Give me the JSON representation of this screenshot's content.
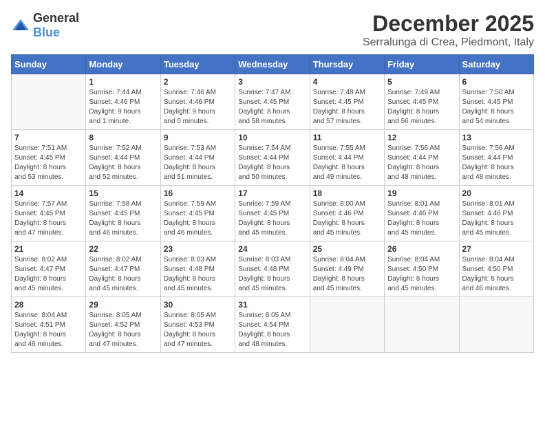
{
  "logo": {
    "general": "General",
    "blue": "Blue"
  },
  "header": {
    "month": "December 2025",
    "location": "Serralunga di Crea, Piedmont, Italy"
  },
  "weekdays": [
    "Sunday",
    "Monday",
    "Tuesday",
    "Wednesday",
    "Thursday",
    "Friday",
    "Saturday"
  ],
  "weeks": [
    [
      {
        "day": "",
        "info": ""
      },
      {
        "day": "1",
        "info": "Sunrise: 7:44 AM\nSunset: 4:46 PM\nDaylight: 9 hours\nand 1 minute."
      },
      {
        "day": "2",
        "info": "Sunrise: 7:46 AM\nSunset: 4:46 PM\nDaylight: 9 hours\nand 0 minutes."
      },
      {
        "day": "3",
        "info": "Sunrise: 7:47 AM\nSunset: 4:45 PM\nDaylight: 8 hours\nand 58 minutes."
      },
      {
        "day": "4",
        "info": "Sunrise: 7:48 AM\nSunset: 4:45 PM\nDaylight: 8 hours\nand 57 minutes."
      },
      {
        "day": "5",
        "info": "Sunrise: 7:49 AM\nSunset: 4:45 PM\nDaylight: 8 hours\nand 56 minutes."
      },
      {
        "day": "6",
        "info": "Sunrise: 7:50 AM\nSunset: 4:45 PM\nDaylight: 8 hours\nand 54 minutes."
      }
    ],
    [
      {
        "day": "7",
        "info": "Sunrise: 7:51 AM\nSunset: 4:45 PM\nDaylight: 8 hours\nand 53 minutes."
      },
      {
        "day": "8",
        "info": "Sunrise: 7:52 AM\nSunset: 4:44 PM\nDaylight: 8 hours\nand 52 minutes."
      },
      {
        "day": "9",
        "info": "Sunrise: 7:53 AM\nSunset: 4:44 PM\nDaylight: 8 hours\nand 51 minutes."
      },
      {
        "day": "10",
        "info": "Sunrise: 7:54 AM\nSunset: 4:44 PM\nDaylight: 8 hours\nand 50 minutes."
      },
      {
        "day": "11",
        "info": "Sunrise: 7:55 AM\nSunset: 4:44 PM\nDaylight: 8 hours\nand 49 minutes."
      },
      {
        "day": "12",
        "info": "Sunrise: 7:56 AM\nSunset: 4:44 PM\nDaylight: 8 hours\nand 48 minutes."
      },
      {
        "day": "13",
        "info": "Sunrise: 7:56 AM\nSunset: 4:44 PM\nDaylight: 8 hours\nand 48 minutes."
      }
    ],
    [
      {
        "day": "14",
        "info": "Sunrise: 7:57 AM\nSunset: 4:45 PM\nDaylight: 8 hours\nand 47 minutes."
      },
      {
        "day": "15",
        "info": "Sunrise: 7:58 AM\nSunset: 4:45 PM\nDaylight: 8 hours\nand 46 minutes."
      },
      {
        "day": "16",
        "info": "Sunrise: 7:59 AM\nSunset: 4:45 PM\nDaylight: 8 hours\nand 46 minutes."
      },
      {
        "day": "17",
        "info": "Sunrise: 7:59 AM\nSunset: 4:45 PM\nDaylight: 8 hours\nand 45 minutes."
      },
      {
        "day": "18",
        "info": "Sunrise: 8:00 AM\nSunset: 4:46 PM\nDaylight: 8 hours\nand 45 minutes."
      },
      {
        "day": "19",
        "info": "Sunrise: 8:01 AM\nSunset: 4:46 PM\nDaylight: 8 hours\nand 45 minutes."
      },
      {
        "day": "20",
        "info": "Sunrise: 8:01 AM\nSunset: 4:46 PM\nDaylight: 8 hours\nand 45 minutes."
      }
    ],
    [
      {
        "day": "21",
        "info": "Sunrise: 8:02 AM\nSunset: 4:47 PM\nDaylight: 8 hours\nand 45 minutes."
      },
      {
        "day": "22",
        "info": "Sunrise: 8:02 AM\nSunset: 4:47 PM\nDaylight: 8 hours\nand 45 minutes."
      },
      {
        "day": "23",
        "info": "Sunrise: 8:03 AM\nSunset: 4:48 PM\nDaylight: 8 hours\nand 45 minutes."
      },
      {
        "day": "24",
        "info": "Sunrise: 8:03 AM\nSunset: 4:48 PM\nDaylight: 8 hours\nand 45 minutes."
      },
      {
        "day": "25",
        "info": "Sunrise: 8:04 AM\nSunset: 4:49 PM\nDaylight: 8 hours\nand 45 minutes."
      },
      {
        "day": "26",
        "info": "Sunrise: 8:04 AM\nSunset: 4:50 PM\nDaylight: 8 hours\nand 45 minutes."
      },
      {
        "day": "27",
        "info": "Sunrise: 8:04 AM\nSunset: 4:50 PM\nDaylight: 8 hours\nand 46 minutes."
      }
    ],
    [
      {
        "day": "28",
        "info": "Sunrise: 8:04 AM\nSunset: 4:51 PM\nDaylight: 8 hours\nand 46 minutes."
      },
      {
        "day": "29",
        "info": "Sunrise: 8:05 AM\nSunset: 4:52 PM\nDaylight: 8 hours\nand 47 minutes."
      },
      {
        "day": "30",
        "info": "Sunrise: 8:05 AM\nSunset: 4:53 PM\nDaylight: 8 hours\nand 47 minutes."
      },
      {
        "day": "31",
        "info": "Sunrise: 8:05 AM\nSunset: 4:54 PM\nDaylight: 8 hours\nand 48 minutes."
      },
      {
        "day": "",
        "info": ""
      },
      {
        "day": "",
        "info": ""
      },
      {
        "day": "",
        "info": ""
      }
    ]
  ]
}
